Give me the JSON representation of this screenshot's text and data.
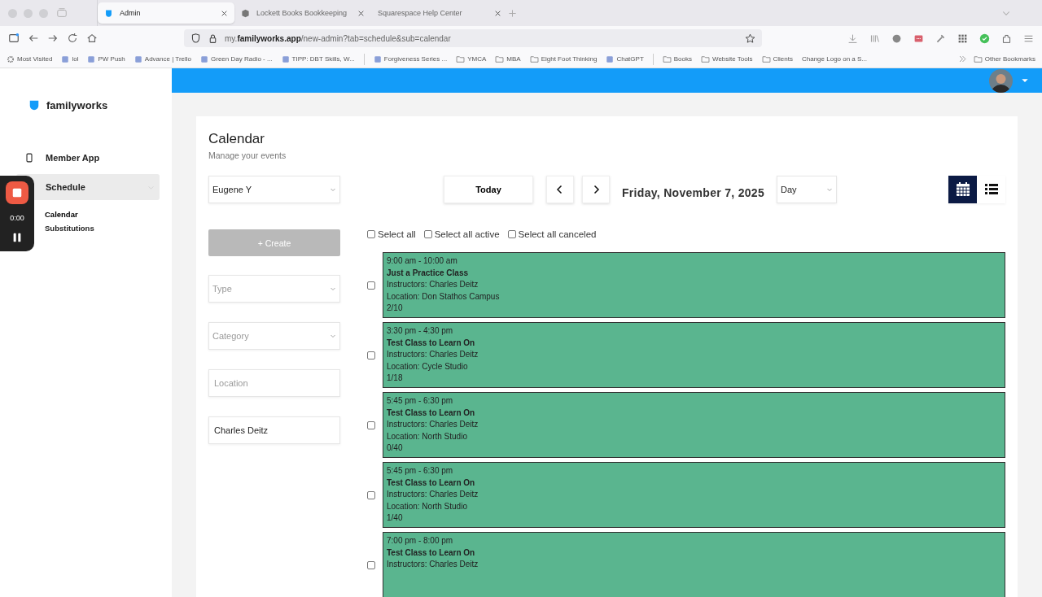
{
  "browser": {
    "tabs": [
      {
        "label": "Admin",
        "selected": true,
        "kind": "shield"
      },
      {
        "label": "Lockett Books Bookkeeping",
        "selected": false,
        "kind": "cube"
      },
      {
        "label": "Squarespace Help Center",
        "selected": false,
        "kind": "none"
      }
    ],
    "url": {
      "host_prefix": "my.",
      "host": "familyworks.app",
      "path": "/new-admin?tab=schedule&sub=calendar"
    },
    "bookmarks": [
      {
        "label": "Most Visited",
        "kind": "gear"
      },
      {
        "label": "lol",
        "kind": "site"
      },
      {
        "label": "PW Push",
        "kind": "site"
      },
      {
        "label": "Advance | Trello",
        "kind": "site"
      },
      {
        "label": "Green Day Radio - ...",
        "kind": "site"
      },
      {
        "label": "TIPP: DBT Skills, W...",
        "kind": "site"
      },
      {
        "label": "Forgiveness Series ...",
        "kind": "site"
      },
      {
        "label": "YMCA",
        "kind": "folder"
      },
      {
        "label": "MBA",
        "kind": "folder"
      },
      {
        "label": "Eight Foot Thinking",
        "kind": "folder"
      },
      {
        "label": "ChatGPT",
        "kind": "site"
      },
      {
        "label": "Books",
        "kind": "folder"
      },
      {
        "label": "Website Tools",
        "kind": "folder"
      },
      {
        "label": "Clients",
        "kind": "folder"
      },
      {
        "label": "Change Logo on a S...",
        "kind": "none"
      }
    ],
    "other_bookmarks": "Other Bookmarks"
  },
  "recorder": {
    "time": "0:00"
  },
  "sidebar": {
    "brand": "familyworks",
    "items": [
      {
        "label": "Member App",
        "selected": false,
        "kind": "phone"
      },
      {
        "label": "Schedule",
        "selected": true,
        "expanded": true,
        "children": [
          {
            "label": "Calendar",
            "selected": true
          },
          {
            "label": "Substitutions",
            "selected": false
          }
        ]
      }
    ]
  },
  "page": {
    "title": "Calendar",
    "subtitle": "Manage your events"
  },
  "filters": {
    "staff": "Eugene Y",
    "create": {
      "label": "+ Create",
      "disabled": true
    },
    "type": {
      "placeholder": "Type"
    },
    "category": {
      "placeholder": "Category"
    },
    "location": {
      "placeholder": "Location"
    },
    "instructor": "Charles Deitz"
  },
  "toolbar": {
    "today": "Today",
    "date": "Friday, November 7, 2025",
    "view_range": "Day",
    "views": [
      {
        "kind": "calendar",
        "selected": true
      },
      {
        "kind": "list",
        "selected": false
      }
    ]
  },
  "select_options": [
    {
      "label": "Select all",
      "checked": false
    },
    {
      "label": "Select all active",
      "checked": false
    },
    {
      "label": "Select all canceled",
      "checked": false
    }
  ],
  "events": [
    {
      "time": "9:00 am - 10:00 am",
      "title": "Just a Practice Class",
      "instructors": "Instructors: Charles Deitz",
      "location": "Location: Don Stathos Campus",
      "count": "2/10",
      "checked": false,
      "color": "#5ab58f"
    },
    {
      "time": "3:30 pm - 4:30 pm",
      "title": "Test Class to Learn On",
      "instructors": "Instructors: Charles Deitz",
      "location": "Location: Cycle Studio",
      "count": "1/18",
      "checked": false,
      "color": "#5ab58f"
    },
    {
      "time": "5:45 pm - 6:30 pm",
      "title": "Test Class to Learn On",
      "instructors": "Instructors: Charles Deitz",
      "location": "Location: North Studio",
      "count": "0/40",
      "checked": false,
      "color": "#5ab58f"
    },
    {
      "time": "5:45 pm - 6:30 pm",
      "title": "Test Class to Learn On",
      "instructors": "Instructors: Charles Deitz",
      "location": "Location: North Studio",
      "count": "1/40",
      "checked": false,
      "color": "#5ab58f"
    },
    {
      "time": "7:00 pm - 8:00 pm",
      "title": "Test Class to Learn On",
      "instructors": "Instructors: Charles Deitz",
      "checked": false,
      "color": "#5ab58f"
    }
  ]
}
